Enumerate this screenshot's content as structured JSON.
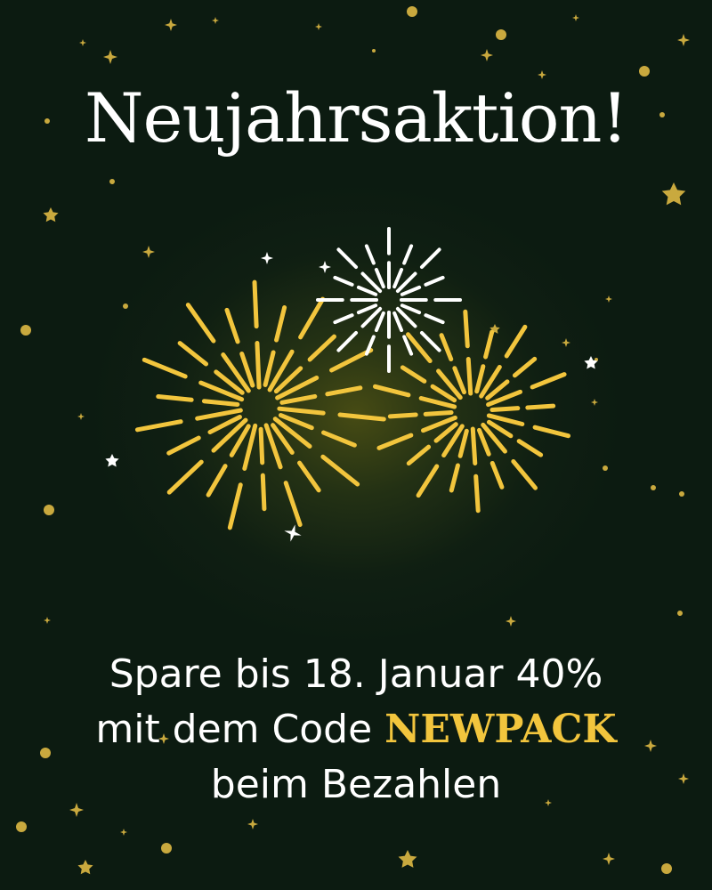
{
  "headline": "Neujahrsaktion!",
  "message": {
    "line1": "Spare bis 18. Januar 40%",
    "line2_prefix": "mit dem Code ",
    "promo_code": "NEWPACK",
    "line3": "beim Bezahlen"
  },
  "colors": {
    "background": "#0c1b11",
    "accent_gold": "#f2c53d",
    "star_gold": "#c9a93e",
    "text": "#ffffff"
  }
}
